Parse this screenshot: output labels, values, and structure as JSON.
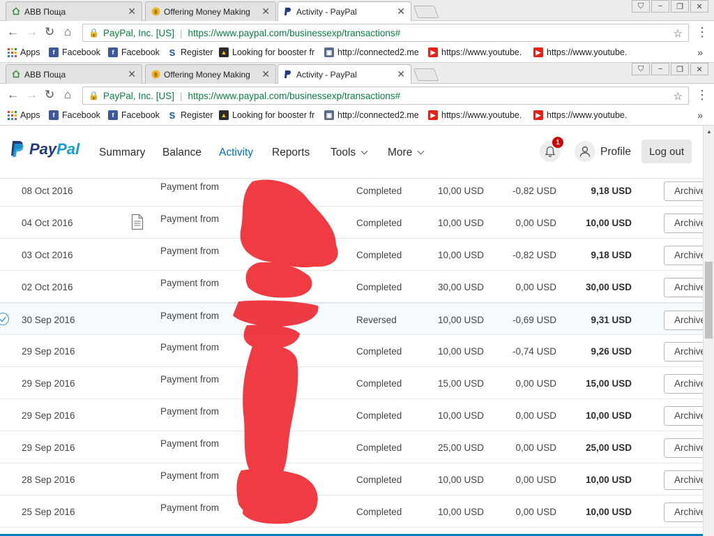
{
  "browser": {
    "tabs": [
      {
        "label": "АВВ Поща",
        "icon": "home-icon",
        "active": false
      },
      {
        "label": "Offering Money Making",
        "icon": "coin-icon",
        "active": false
      },
      {
        "label": "Activity - PayPal",
        "icon": "paypal-icon",
        "active": true
      }
    ],
    "omnibox": {
      "secure_label": "PayPal, Inc. [US]",
      "url": "https://www.paypal.com/businessexp/transactions#"
    },
    "bookmarks": [
      {
        "label": "Apps",
        "icon": "apps-grid-icon"
      },
      {
        "label": "Facebook",
        "icon": "facebook-icon"
      },
      {
        "label": "Facebook",
        "icon": "facebook-icon"
      },
      {
        "label": "Register",
        "icon": "register-icon"
      },
      {
        "label": "Looking for booster fr",
        "icon": "booster-icon"
      },
      {
        "label": "http://connected2.me",
        "icon": "connected2-icon"
      },
      {
        "label": "https://www.youtube.",
        "icon": "youtube-icon"
      },
      {
        "label": "https://www.youtube.",
        "icon": "youtube-icon"
      }
    ],
    "more_bookmarks": "»"
  },
  "paypal": {
    "logo_pay": "Pay",
    "logo_pal": "Pal",
    "nav": [
      "Summary",
      "Balance",
      "Activity",
      "Reports",
      "Tools",
      "More"
    ],
    "active_nav": "Activity",
    "notification_count": "1",
    "profile_label": "Profile",
    "logout_label": "Log out",
    "colors": {
      "brand_dark": "#253b80",
      "brand_light": "#179bd7",
      "link": "#0070ba",
      "badge": "#d20000",
      "redaction": "#ee1c25"
    }
  },
  "transactions": [
    {
      "date": "08 Oct 2016",
      "description": "Payment from",
      "status": "Completed",
      "gross": "10,00 USD",
      "fee": "-0,82 USD",
      "net": "9,18 USD",
      "action": "Archive"
    },
    {
      "date": "04 Oct 2016",
      "description": "Payment from",
      "status": "Completed",
      "gross": "10,00 USD",
      "fee": "0,00 USD",
      "net": "10,00 USD",
      "action": "Archive",
      "has_note_icon": true
    },
    {
      "date": "03 Oct 2016",
      "description": "Payment from",
      "status": "Completed",
      "gross": "10,00 USD",
      "fee": "-0,82 USD",
      "net": "9,18 USD",
      "action": "Archive"
    },
    {
      "date": "02 Oct 2016",
      "description": "Payment from",
      "status": "Completed",
      "gross": "30,00 USD",
      "fee": "0,00 USD",
      "net": "30,00 USD",
      "action": "Archive"
    },
    {
      "date": "30 Sep 2016",
      "description": "Payment from",
      "status": "Reversed",
      "gross": "10,00 USD",
      "fee": "-0,69 USD",
      "net": "9,31 USD",
      "action": "Archive",
      "selected": true
    },
    {
      "date": "29 Sep 2016",
      "description": "Payment from",
      "status": "Completed",
      "gross": "10,00 USD",
      "fee": "-0,74 USD",
      "net": "9,26 USD",
      "action": "Archive"
    },
    {
      "date": "29 Sep 2016",
      "description": "Payment from",
      "status": "Completed",
      "gross": "15,00 USD",
      "fee": "0,00 USD",
      "net": "15,00 USD",
      "action": "Archive"
    },
    {
      "date": "29 Sep 2016",
      "description": "Payment from",
      "status": "Completed",
      "gross": "10,00 USD",
      "fee": "0,00 USD",
      "net": "10,00 USD",
      "action": "Archive"
    },
    {
      "date": "29 Sep 2016",
      "description": "Payment from",
      "status": "Completed",
      "gross": "25,00 USD",
      "fee": "0,00 USD",
      "net": "25,00 USD",
      "action": "Archive"
    },
    {
      "date": "28 Sep 2016",
      "description": "Payment from",
      "status": "Completed",
      "gross": "10,00 USD",
      "fee": "0,00 USD",
      "net": "10,00 USD",
      "action": "Archive"
    },
    {
      "date": "25 Sep 2016",
      "description": "Payment from",
      "status": "Completed",
      "gross": "10,00 USD",
      "fee": "0,00 USD",
      "net": "10,00 USD",
      "action": "Archive"
    }
  ]
}
